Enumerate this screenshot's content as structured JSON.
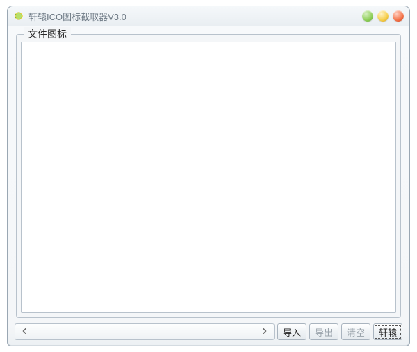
{
  "window": {
    "title": "轩辕ICO图标截取器V3.0"
  },
  "group": {
    "label": "文件图标"
  },
  "buttons": {
    "import": "导入",
    "export": "导出",
    "clear": "清空",
    "about": "轩辕"
  },
  "state": {
    "export_enabled": false,
    "clear_enabled": false
  }
}
